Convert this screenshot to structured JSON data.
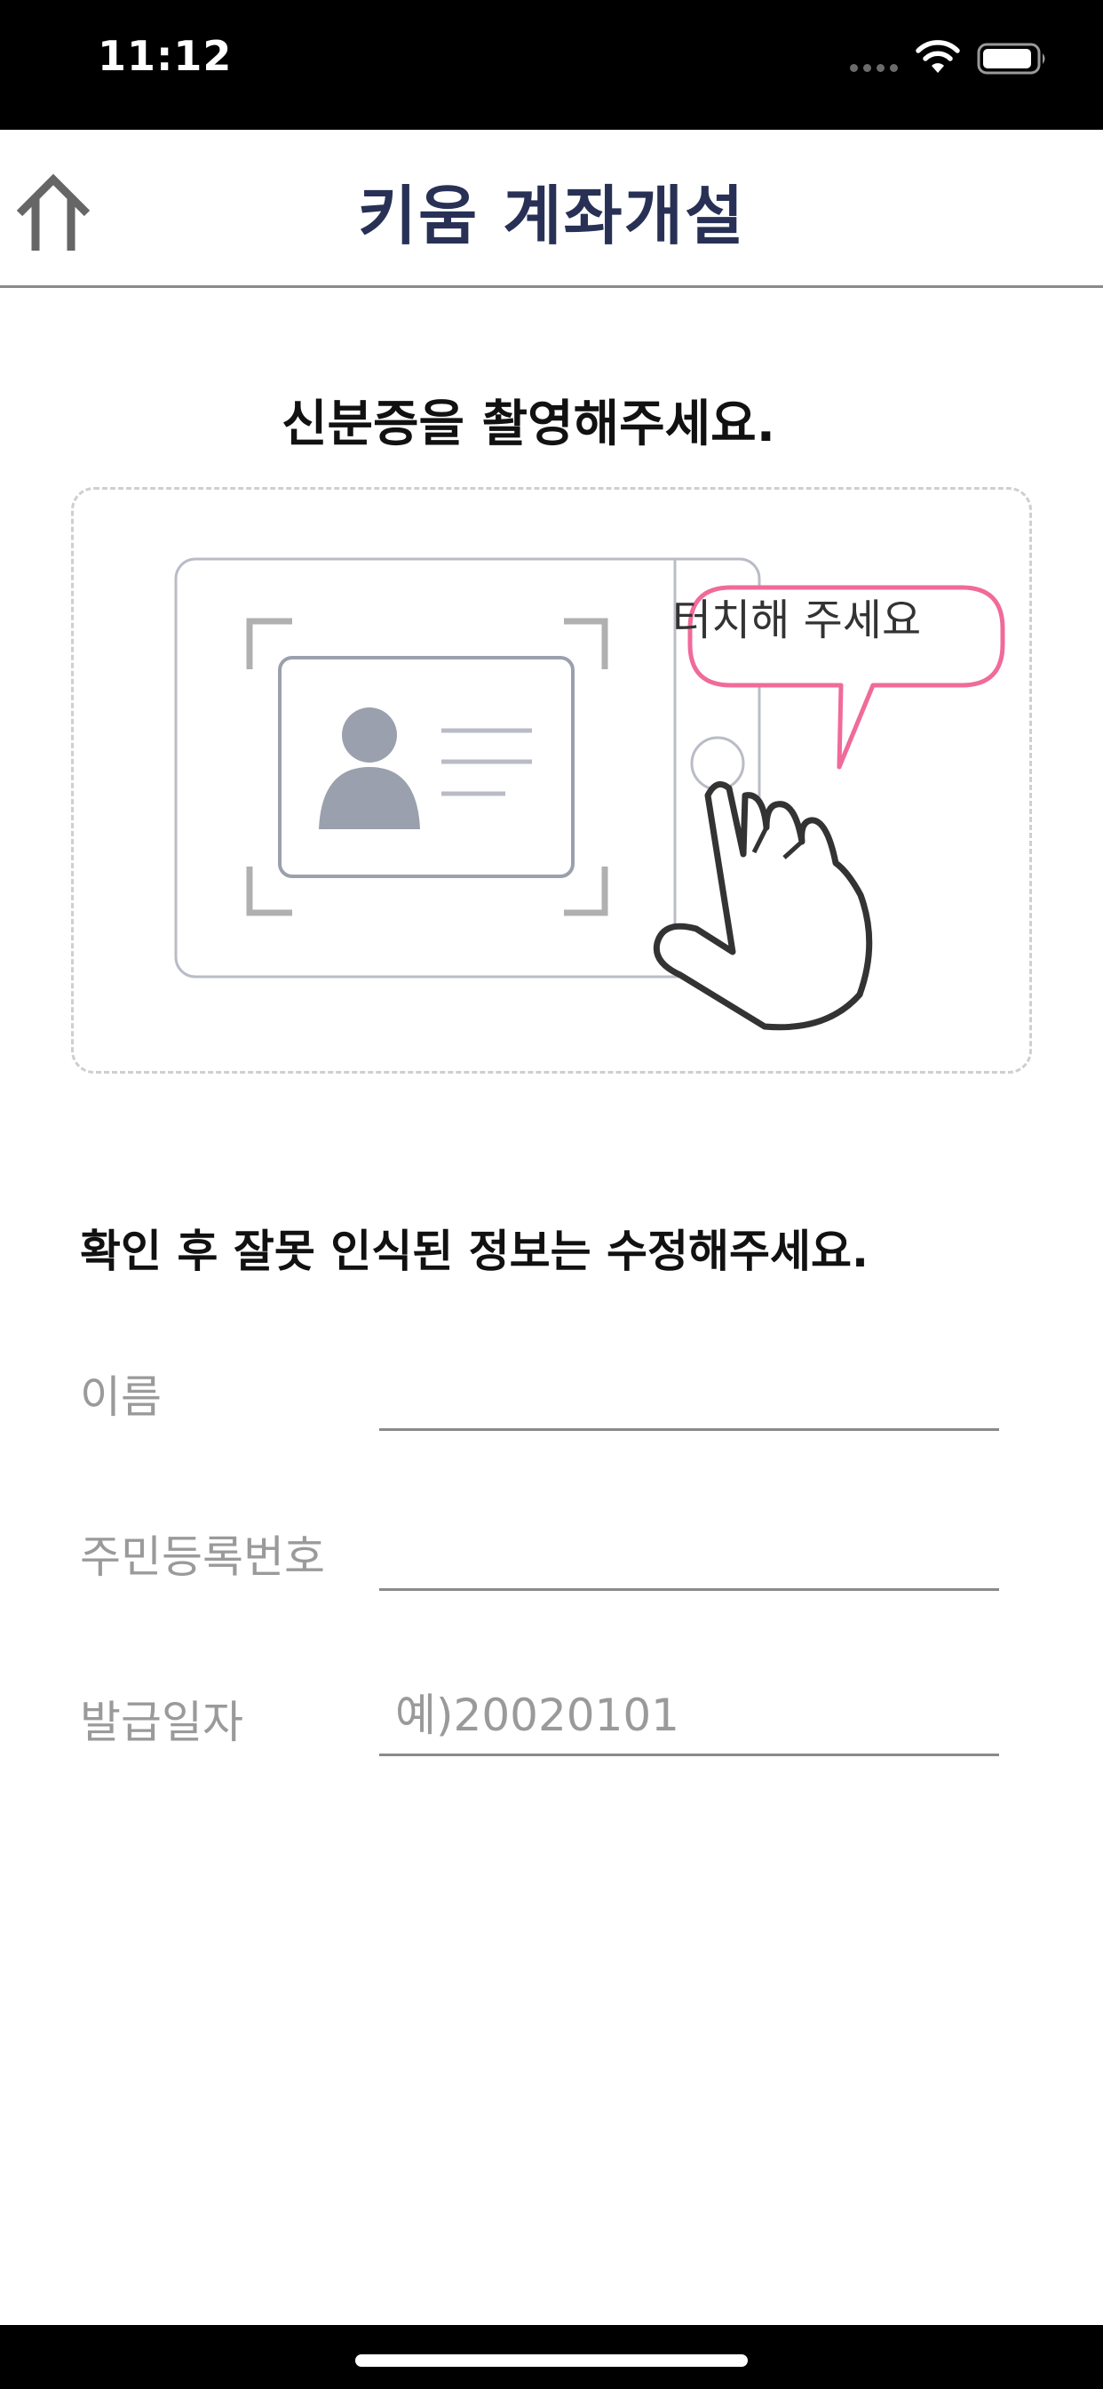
{
  "status_bar": {
    "time": "11:12",
    "icons": [
      "signal-dots-icon",
      "wifi-icon",
      "battery-icon"
    ]
  },
  "header": {
    "title": "키움 계좌개설",
    "home_icon": "home-arrow-icon"
  },
  "capture": {
    "title": "신분증을 촬영해주세요.",
    "bubble_text": "터치해 주세요",
    "accent_color": "#f06a9a"
  },
  "form": {
    "instruction": "확인 후 잘못 인식된 정보는 수정해주세요.",
    "fields": [
      {
        "label": "이름",
        "value": "",
        "placeholder": ""
      },
      {
        "label": "주민등록번호",
        "value": "",
        "placeholder": ""
      },
      {
        "label": "발급일자",
        "value": "",
        "placeholder": "예)20020101"
      }
    ]
  },
  "colors": {
    "title": "#283155",
    "label": "#9a9a9a",
    "divider": "#8a8a8a"
  }
}
